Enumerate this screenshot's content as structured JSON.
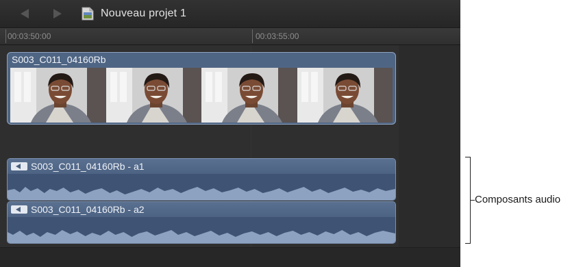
{
  "titlebar": {
    "back_icon": "chevron-left-icon",
    "forward_icon": "chevron-right-icon",
    "project_icon": "project-document-icon",
    "project_name": "Nouveau projet 1"
  },
  "ruler": {
    "timecodes": [
      "00:03:50:00",
      "00:03:55:00"
    ]
  },
  "video_clip": {
    "name": "S003_C011_04160Rb",
    "frame_count": 4
  },
  "audio_components": [
    {
      "name": "S003_C011_04160Rb - a1",
      "icon": "audio-track-icon"
    },
    {
      "name": "S003_C011_04160Rb - a2",
      "icon": "audio-track-icon"
    }
  ],
  "callout": {
    "label": "Composants audio"
  },
  "colors": {
    "timeline_bg": "#2a2a2a",
    "clip_blue": "#4f6584",
    "clip_border": "#8fa4c2",
    "waveform": "#8da2c0"
  }
}
